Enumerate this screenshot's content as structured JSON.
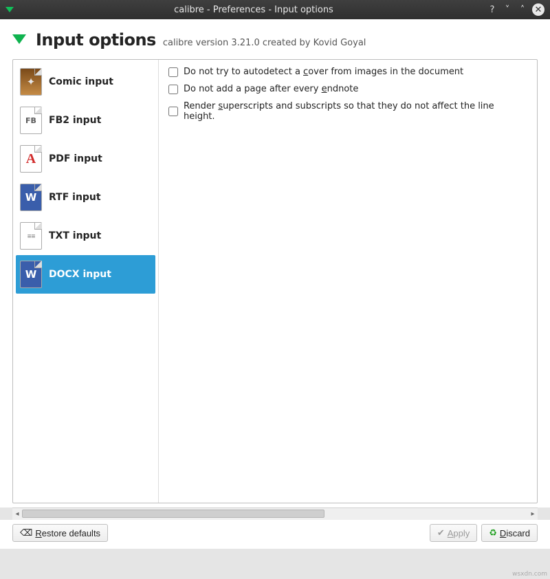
{
  "window": {
    "title": "calibre - Preferences - Input options"
  },
  "header": {
    "title": "Input options",
    "subtitle": "calibre version 3.21.0 created by Kovid Goyal"
  },
  "sidebar": {
    "items": [
      {
        "label": "Comic input",
        "selected": false,
        "icon": "comic"
      },
      {
        "label": "FB2 input",
        "selected": false,
        "icon": "fb2"
      },
      {
        "label": "PDF input",
        "selected": false,
        "icon": "pdf"
      },
      {
        "label": "RTF input",
        "selected": false,
        "icon": "rtf"
      },
      {
        "label": "TXT input",
        "selected": false,
        "icon": "txt"
      },
      {
        "label": "DOCX input",
        "selected": true,
        "icon": "docx"
      }
    ]
  },
  "options": [
    {
      "label_pre": "Do not try to autodetect a ",
      "label_u": "c",
      "label_post": "over from images in the document",
      "checked": false
    },
    {
      "label_pre": "Do not add a page after every ",
      "label_u": "e",
      "label_post": "ndnote",
      "checked": false
    },
    {
      "label_pre": "Render ",
      "label_u": "s",
      "label_post": "uperscripts and subscripts so that they do not affect the line height.",
      "checked": false
    }
  ],
  "footer": {
    "restore": {
      "label_pre": "",
      "label_u": "R",
      "label_post": "estore defaults"
    },
    "apply": {
      "label_pre": "",
      "label_u": "A",
      "label_post": "pply"
    },
    "discard": {
      "label_pre": "",
      "label_u": "D",
      "label_post": "iscard"
    }
  },
  "watermark": "wsxdn.com"
}
